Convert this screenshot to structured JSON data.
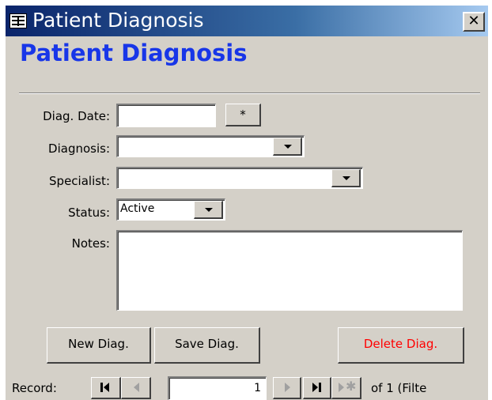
{
  "window": {
    "title": "Patient Diagnosis",
    "app_icon": "form-icon",
    "close_label": "✕"
  },
  "form": {
    "heading": "Patient Diagnosis",
    "heading_color": "#1836e8"
  },
  "fields": {
    "diag_date_label": "Diag. Date:",
    "diag_date_value": "",
    "diag_date_button_label": "*",
    "diagnosis_label": "Diagnosis:",
    "diagnosis_value": "",
    "specialist_label": "Specialist:",
    "specialist_value": "",
    "status_label": "Status:",
    "status_value": "Active",
    "notes_label": "Notes:",
    "notes_value": ""
  },
  "buttons": {
    "new_label": "New Diag.",
    "save_label": "Save Diag.",
    "delete_label": "Delete Diag.",
    "delete_color": "#ff0000"
  },
  "navigator": {
    "record_label": "Record:",
    "current_record": "1",
    "of_text": "of  1 (Filte",
    "icons": [
      "first-record-icon",
      "previous-record-icon",
      "next-record-icon",
      "last-record-icon",
      "new-record-icon"
    ]
  }
}
